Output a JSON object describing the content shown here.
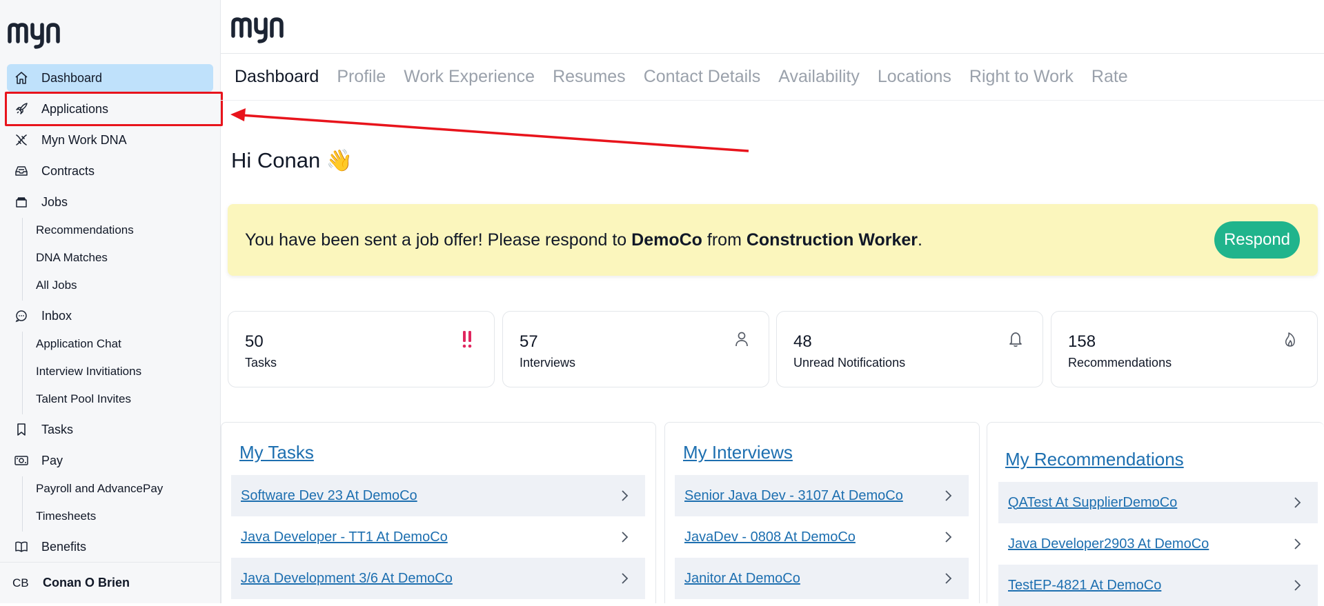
{
  "brand": {
    "logo_text": "myn",
    "accent": "#20b48c",
    "link_color": "#1d6fb0"
  },
  "sidebar": {
    "items": [
      {
        "label": "Dashboard",
        "icon": "home-icon"
      },
      {
        "label": "Applications",
        "icon": "rocket-icon"
      },
      {
        "label": "Myn Work DNA",
        "icon": "dna-icon"
      },
      {
        "label": "Contracts",
        "icon": "inbox-tray-icon"
      },
      {
        "label": "Jobs",
        "icon": "briefcase-icon"
      },
      {
        "label": "Inbox",
        "icon": "chat-bubble-icon"
      },
      {
        "label": "Tasks",
        "icon": "bookmark-icon"
      },
      {
        "label": "Pay",
        "icon": "money-icon"
      },
      {
        "label": "Benefits",
        "icon": "book-icon"
      }
    ],
    "jobs_sub": [
      "Recommendations",
      "DNA Matches",
      "All Jobs"
    ],
    "inbox_sub": [
      "Application Chat",
      "Interview Invitiations",
      "Talent Pool Invites"
    ],
    "pay_sub": [
      "Payroll and AdvancePay",
      "Timesheets"
    ],
    "user": {
      "initials": "CB",
      "name": "Conan O Brien"
    }
  },
  "tabs": [
    "Dashboard",
    "Profile",
    "Work Experience",
    "Resumes",
    "Contact Details",
    "Availability",
    "Locations",
    "Right to Work",
    "Rate"
  ],
  "greeting": "Hi Conan 👋",
  "offer": {
    "prefix": "You have been sent a job offer! Please respond to ",
    "company": "DemoCo",
    "middle": " from ",
    "job": "Construction Worker",
    "suffix": ".",
    "button": "Respond"
  },
  "stats": [
    {
      "value": "50",
      "label": "Tasks",
      "icon": "double-exclamation-icon"
    },
    {
      "value": "57",
      "label": "Interviews",
      "icon": "user-icon"
    },
    {
      "value": "48",
      "label": "Unread Notifications",
      "icon": "bell-icon"
    },
    {
      "value": "158",
      "label": "Recommendations",
      "icon": "flame-icon"
    }
  ],
  "panels": {
    "tasks": {
      "title": "My Tasks",
      "rows": [
        "Software Dev 23 At DemoCo",
        "Java Developer - TT1 At DemoCo",
        "Java Development 3/6 At DemoCo"
      ]
    },
    "interviews": {
      "title": "My Interviews",
      "rows": [
        "Senior Java Dev - 3107 At DemoCo",
        "JavaDev - 0808 At DemoCo",
        "Janitor At DemoCo"
      ]
    },
    "recommendations": {
      "title": "My Recommendations",
      "rows": [
        "QATest At SupplierDemoCo",
        "Java Developer2903 At DemoCo",
        "TestEP-4821 At DemoCo"
      ]
    }
  }
}
